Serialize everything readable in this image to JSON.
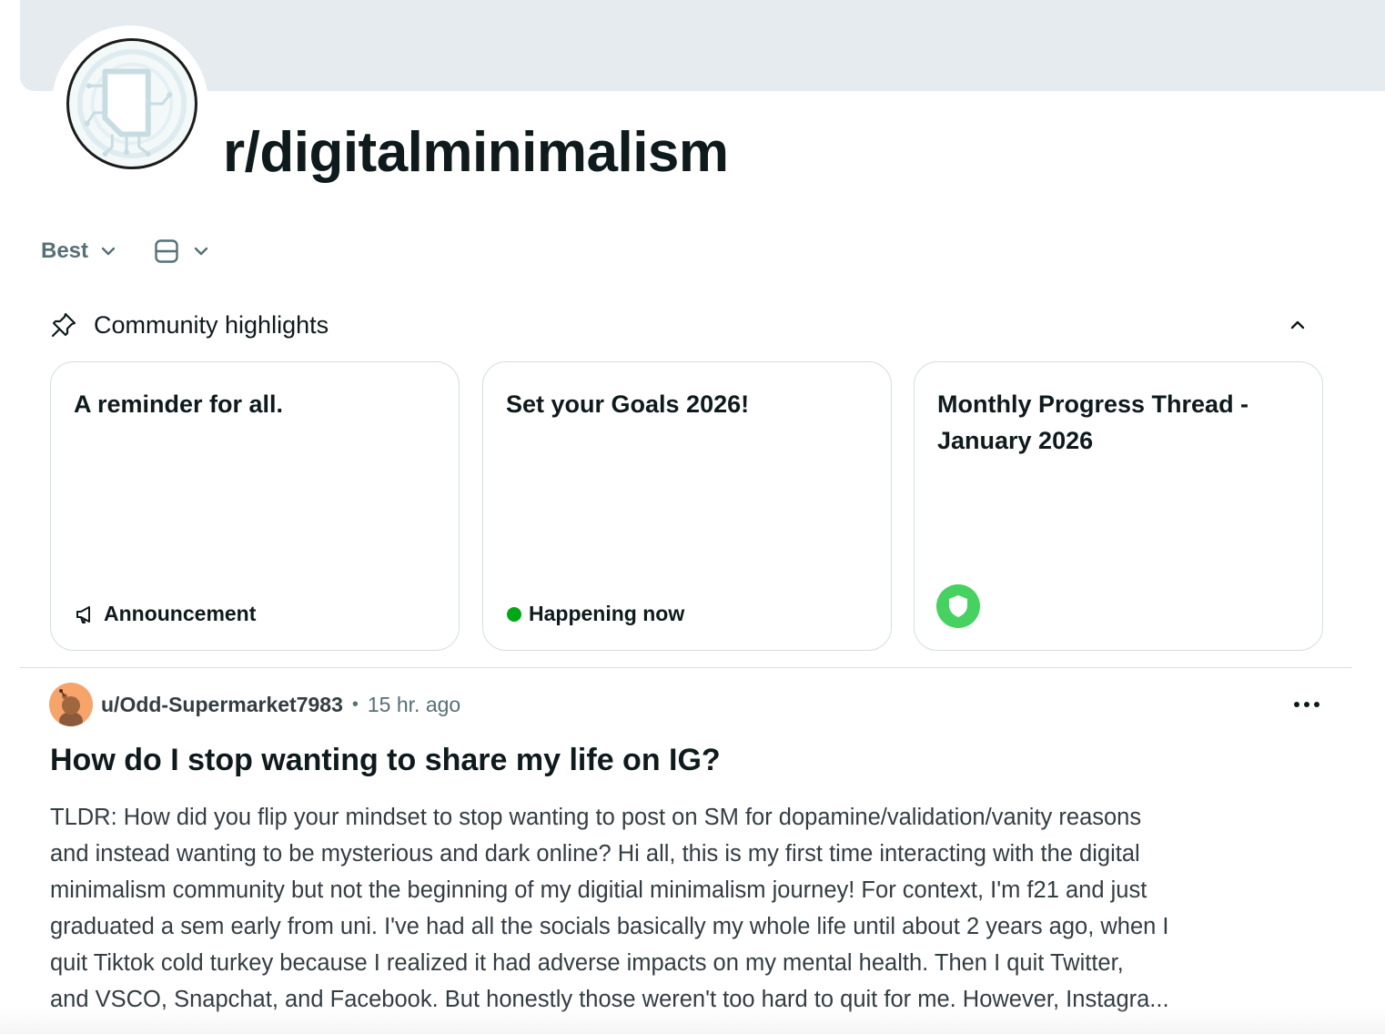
{
  "subreddit": {
    "name": "r/digitalminimalism"
  },
  "feed_controls": {
    "sort_label": "Best",
    "view_icon": "card-view-icon"
  },
  "highlights": {
    "title": "Community highlights",
    "cards": [
      {
        "title": "A reminder for all.",
        "footer_label": "Announcement",
        "footer_icon": "megaphone-icon"
      },
      {
        "title": "Set your Goals 2026!",
        "footer_label": "Happening now",
        "footer_icon": "live-dot",
        "status_color": "#01a816"
      },
      {
        "title": "Monthly Progress Thread - January 2026",
        "footer_icon": "shield-icon",
        "badge_color": "#46d160"
      }
    ]
  },
  "post": {
    "author": "u/Odd-Supermarket7983",
    "separator": "•",
    "time_ago": "15 hr. ago",
    "title": "How do I stop wanting to share my life on IG?",
    "body_lines": [
      "TLDR: How did you flip your mindset to stop wanting to post on SM for dopamine/validation/vanity reasons",
      "and instead wanting to be mysterious and dark online? Hi all, this is my first time interacting with the digital",
      "minimalism community but not the beginning of my digitial minimalism journey! For context, I'm f21 and just",
      "graduated a sem early from uni. I've had all the socials basically my whole life until about 2 years ago, when I",
      "quit Tiktok cold turkey because I realized it had adverse impacts on my mental health. Then I quit Twitter,",
      "and VSCO, Snapchat, and Facebook. But honestly those weren't too hard to quit for me. However, Instagra..."
    ]
  }
}
